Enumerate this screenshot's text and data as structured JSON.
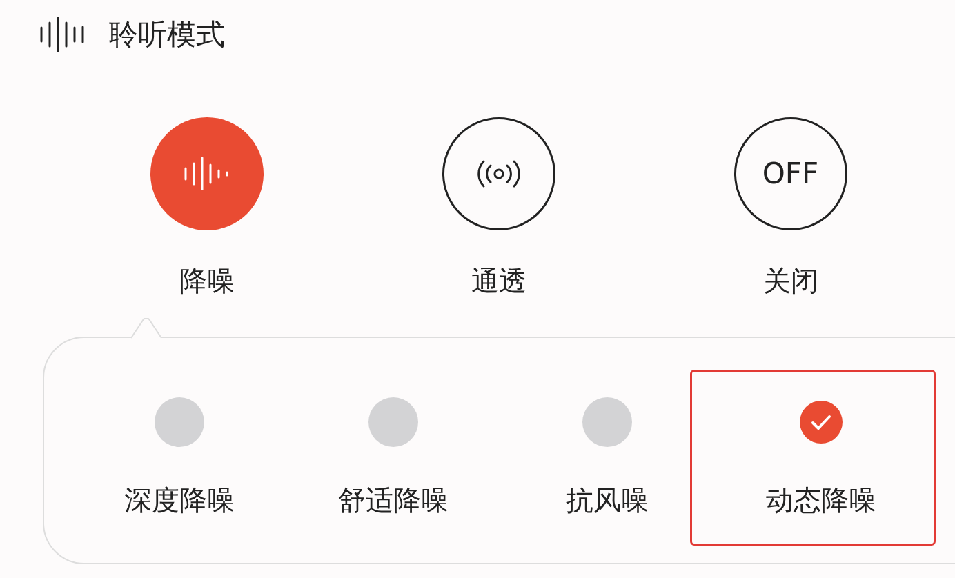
{
  "title": "聆听模式",
  "modes": [
    {
      "label": "降噪",
      "kind": "noise_cancel",
      "selected": true
    },
    {
      "label": "通透",
      "kind": "transparency",
      "selected": false
    },
    {
      "label": "关闭",
      "kind": "off",
      "icon_text": "OFF",
      "selected": false
    }
  ],
  "sub_modes": [
    {
      "label": "深度降噪",
      "selected": false,
      "highlighted": false
    },
    {
      "label": "舒适降噪",
      "selected": false,
      "highlighted": false
    },
    {
      "label": "抗风噪",
      "selected": false,
      "highlighted": false
    },
    {
      "label": "动态降噪",
      "selected": true,
      "highlighted": true
    }
  ]
}
